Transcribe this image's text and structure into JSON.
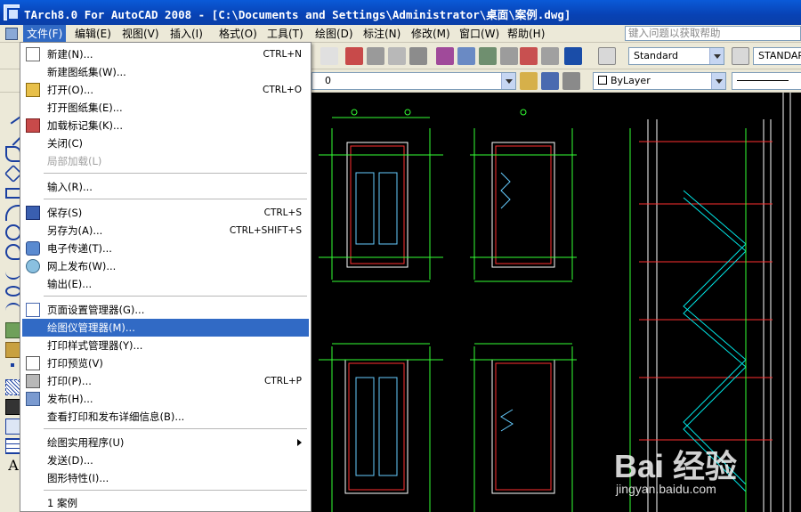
{
  "window": {
    "title": "TArch8.0 For AutoCAD 2008 - [C:\\Documents and Settings\\Administrator\\桌面\\案例.dwg]"
  },
  "menubar": {
    "items": [
      "文件(F)",
      "编辑(E)",
      "视图(V)",
      "插入(I)",
      "格式(O)",
      "工具(T)",
      "绘图(D)",
      "标注(N)",
      "修改(M)",
      "窗口(W)",
      "帮助(H)"
    ],
    "active": "文件(F)",
    "help_placeholder": "键入问题以获取帮助"
  },
  "toolbar": {
    "text_style": "Standard",
    "dim_style": "STANDARD",
    "layer": "0",
    "color": "ByLayer"
  },
  "file_menu": {
    "items": [
      {
        "label": "新建(N)...",
        "shortcut": "CTRL+N",
        "icon": "new-file-icon"
      },
      {
        "label": "新建图纸集(W)...",
        "shortcut": ""
      },
      {
        "label": "打开(O)...",
        "shortcut": "CTRL+O",
        "icon": "open-folder-icon"
      },
      {
        "label": "打开图纸集(E)...",
        "shortcut": ""
      },
      {
        "label": "加载标记集(K)...",
        "shortcut": "",
        "icon": "markup-icon"
      },
      {
        "label": "关闭(C)",
        "shortcut": ""
      },
      {
        "label": "局部加载(L)",
        "shortcut": "",
        "disabled": true
      },
      {
        "label": "输入(R)...",
        "shortcut": ""
      },
      {
        "label": "保存(S)",
        "shortcut": "CTRL+S",
        "icon": "save-icon"
      },
      {
        "label": "另存为(A)...",
        "shortcut": "CTRL+SHIFT+S"
      },
      {
        "label": "电子传递(T)...",
        "shortcut": "",
        "icon": "etransmit-icon"
      },
      {
        "label": "网上发布(W)...",
        "shortcut": "",
        "icon": "publish-web-icon"
      },
      {
        "label": "输出(E)...",
        "shortcut": ""
      },
      {
        "label": "页面设置管理器(G)...",
        "shortcut": "",
        "icon": "page-setup-icon"
      },
      {
        "label": "绘图仪管理器(M)...",
        "shortcut": "",
        "highlighted": true
      },
      {
        "label": "打印样式管理器(Y)...",
        "shortcut": ""
      },
      {
        "label": "打印预览(V)",
        "shortcut": "",
        "icon": "print-preview-icon"
      },
      {
        "label": "打印(P)...",
        "shortcut": "CTRL+P",
        "icon": "print-icon"
      },
      {
        "label": "发布(H)...",
        "shortcut": "",
        "icon": "publish-icon"
      },
      {
        "label": "查看打印和发布详细信息(B)...",
        "shortcut": ""
      },
      {
        "label": "绘图实用程序(U)",
        "shortcut": "",
        "submenu": true
      },
      {
        "label": "发送(D)...",
        "shortcut": ""
      },
      {
        "label": "图形特性(I)...",
        "shortcut": ""
      },
      {
        "label": "1 案例",
        "shortcut": ""
      }
    ]
  },
  "watermark": {
    "brand": "Bai 经验",
    "url": "jingyan.baidu.com"
  }
}
